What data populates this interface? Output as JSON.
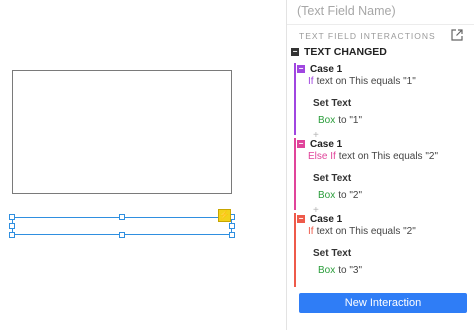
{
  "panel": {
    "name_placeholder": "(Text Field Name)",
    "section_title": "TEXT FIELD INTERACTIONS",
    "event": {
      "toggle": "−",
      "label": "TEXT CHANGED"
    },
    "cases": [
      {
        "title": "Case 1",
        "color": "#a046e0",
        "keyword": "If",
        "condition": "text on This equals \"1\"",
        "action": "Set Text",
        "target": "Box",
        "detail": "to \"1\"",
        "plus": "+"
      },
      {
        "title": "Case 1",
        "color": "#e0449a",
        "keyword": "Else If",
        "condition": "text on This equals \"2\"",
        "action": "Set Text",
        "target": "Box",
        "detail": "to \"2\"",
        "plus": "+"
      },
      {
        "title": "Case 1",
        "color": "#ee5a4a",
        "keyword": "If",
        "condition": "text on This equals \"2\"",
        "action": "Set Text",
        "target": "Box",
        "detail": "to \"3\"",
        "plus": "+"
      }
    ],
    "new_interaction": "New Interaction"
  },
  "canvas": {
    "interaction_badge": "⚡"
  },
  "colors": {
    "accent": "#2f7df6",
    "selection": "#2f8fe0",
    "target_green": "#2a9d3a"
  }
}
